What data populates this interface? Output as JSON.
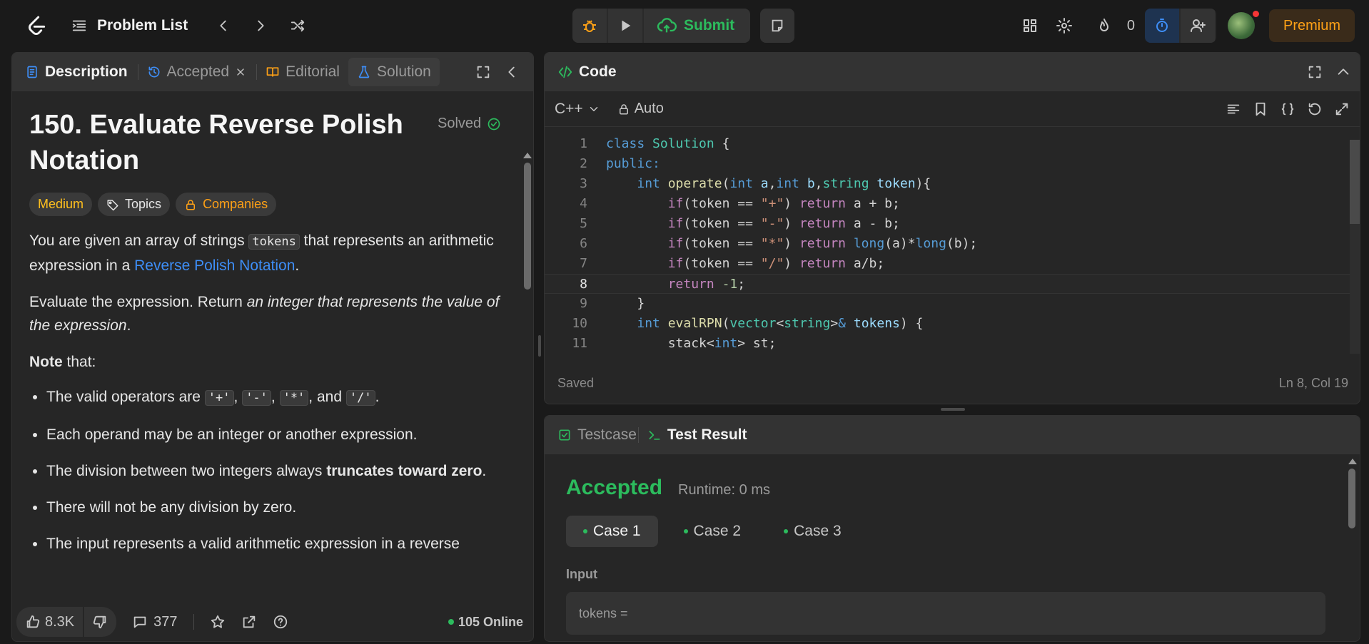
{
  "topbar": {
    "title": "Problem List",
    "submit_label": "Submit",
    "streak_count": "0",
    "premium_label": "Premium"
  },
  "description_panel": {
    "tabs": [
      {
        "label": "Description"
      },
      {
        "label": "Accepted"
      },
      {
        "label": "Editorial"
      },
      {
        "label": "Solution"
      }
    ],
    "title": "150. Evaluate Reverse Polish Notation",
    "solved_label": "Solved",
    "chips": {
      "difficulty": "Medium",
      "topics": "Topics",
      "companies": "Companies"
    },
    "p1_a": "You are given an array of strings ",
    "p1_code": "tokens",
    "p1_b": " that represents an arithmetic expression in a ",
    "p1_link": "Reverse Polish Notation",
    "p1_c": ".",
    "p2_a": "Evaluate the expression. Return ",
    "p2_em": "an integer that represents the value of the expression",
    "p2_b": ".",
    "note_bold": "Note",
    "note_rest": " that:",
    "bullets": {
      "b1_a": "The valid operators are ",
      "b1_op1": "'+'",
      "b1_sep1": ", ",
      "b1_op2": "'-'",
      "b1_sep2": ", ",
      "b1_op3": "'*'",
      "b1_sep3": ", and ",
      "b1_op4": "'/'",
      "b1_end": ".",
      "b2": "Each operand may be an integer or another expression.",
      "b3_a": "The division between two integers always ",
      "b3_bold": "truncates toward zero",
      "b3_end": ".",
      "b4": "There will not be any division by zero.",
      "b5": "The input represents a valid arithmetic expression in a reverse"
    },
    "footer": {
      "likes": "8.3K",
      "comments": "377",
      "online": "105 Online"
    }
  },
  "code_panel": {
    "title": "Code",
    "language": "C++",
    "mode": "Auto",
    "status": "Saved",
    "cursor": "Ln 8, Col 19",
    "lines": [
      {
        "n": "1"
      },
      {
        "n": "2"
      },
      {
        "n": "3"
      },
      {
        "n": "4"
      },
      {
        "n": "5"
      },
      {
        "n": "6"
      },
      {
        "n": "7"
      },
      {
        "n": "8"
      },
      {
        "n": "9"
      },
      {
        "n": "10"
      },
      {
        "n": "11"
      }
    ],
    "tokens": {
      "class": "class",
      "Solution": "Solution",
      "brace_open": " {",
      "public": "public:",
      "int": "int",
      "operate": "operate",
      "lparen": "(",
      "a": "a",
      "comma": ",",
      "b": "b",
      "string": "string",
      "token": "token",
      "rparen_brace": "){",
      "if": "if",
      "token_eq": "(token == ",
      "plus": "\"+\"",
      "minus": "\"-\"",
      "star": "\"*\"",
      "slash": "\"/\"",
      "close_paren": ") ",
      "return": "return",
      "a_plus_b": " a + b;",
      "a_minus_b": " a - b;",
      "long": "long",
      "long_a": "(a)*",
      "long_b": "(b);",
      "a_div_b": " a/b;",
      "neg_one": "-1",
      "semi": ";",
      "close_brace": "}",
      "evalRPN": "evalRPN",
      "vector": "vector",
      "lt": "<",
      "gt": ">",
      "amp": "&",
      "tokens": "tokens",
      "rparen_open": ") {",
      "stack": "stack",
      "st": " st;"
    }
  },
  "result_panel": {
    "tabs": [
      {
        "label": "Testcase"
      },
      {
        "label": "Test Result"
      }
    ],
    "verdict": "Accepted",
    "runtime": "Runtime: 0 ms",
    "cases": [
      {
        "label": "Case 1"
      },
      {
        "label": "Case 2"
      },
      {
        "label": "Case 3"
      }
    ],
    "input_label": "Input",
    "input_value": "tokens ="
  },
  "colors": {
    "accent_green": "#2cbb5d",
    "medium": "#ffc01e",
    "premium": "#ffa116",
    "link": "#3e8ef7"
  }
}
